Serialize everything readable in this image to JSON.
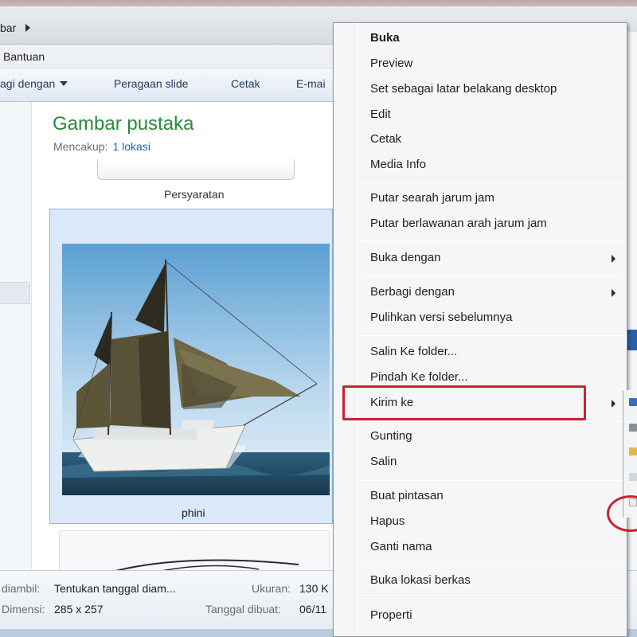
{
  "address": {
    "crumb": "bar"
  },
  "menubar": {
    "help": "Bantuan"
  },
  "toolbar": {
    "share_with": "agi dengan",
    "slideshow": "Peragaan slide",
    "print": "Cetak",
    "email": "E-mai"
  },
  "library": {
    "title": "Gambar pustaka",
    "includes_label": "Mencakup:",
    "includes_link": "1 lokasi"
  },
  "files": {
    "prev_caption": "Persyaratan",
    "selected_caption": "phini"
  },
  "details": {
    "date_taken_label": "diambil:",
    "date_taken_value": "Tentukan tanggal diam...",
    "dimensions_label": "Dimensi:",
    "dimensions_value": "285 x 257",
    "size_label": "Ukuran:",
    "size_value": "130 K",
    "created_label": "Tanggal dibuat:",
    "created_value": "06/11"
  },
  "context_menu": {
    "items": [
      {
        "label": "Buka",
        "bold": true
      },
      {
        "label": "Preview"
      },
      {
        "label": "Set sebagai latar belakang desktop"
      },
      {
        "label": "Edit"
      },
      {
        "label": "Cetak"
      },
      {
        "label": "Media Info"
      },
      {
        "label": "Putar searah jarum jam"
      },
      {
        "label": "Putar berlawanan arah jarum jam"
      },
      {
        "label": "Buka dengan",
        "submenu": true
      },
      {
        "label": "Berbagi dengan",
        "submenu": true
      },
      {
        "label": "Pulihkan versi sebelumnya"
      },
      {
        "label": "Salin Ke folder..."
      },
      {
        "label": "Pindah Ke folder..."
      },
      {
        "label": "Kirim ke",
        "submenu": true,
        "highlighted": true
      },
      {
        "label": "Gunting"
      },
      {
        "label": "Salin"
      },
      {
        "label": "Buat pintasan"
      },
      {
        "label": "Hapus"
      },
      {
        "label": "Ganti nama"
      },
      {
        "label": "Buka lokasi berkas"
      },
      {
        "label": "Properti"
      }
    ]
  },
  "colors": {
    "library_title": "#2a8a3a",
    "link": "#2266bb",
    "selection": "#dbe9f8",
    "annotation_red": "#d0202c"
  }
}
